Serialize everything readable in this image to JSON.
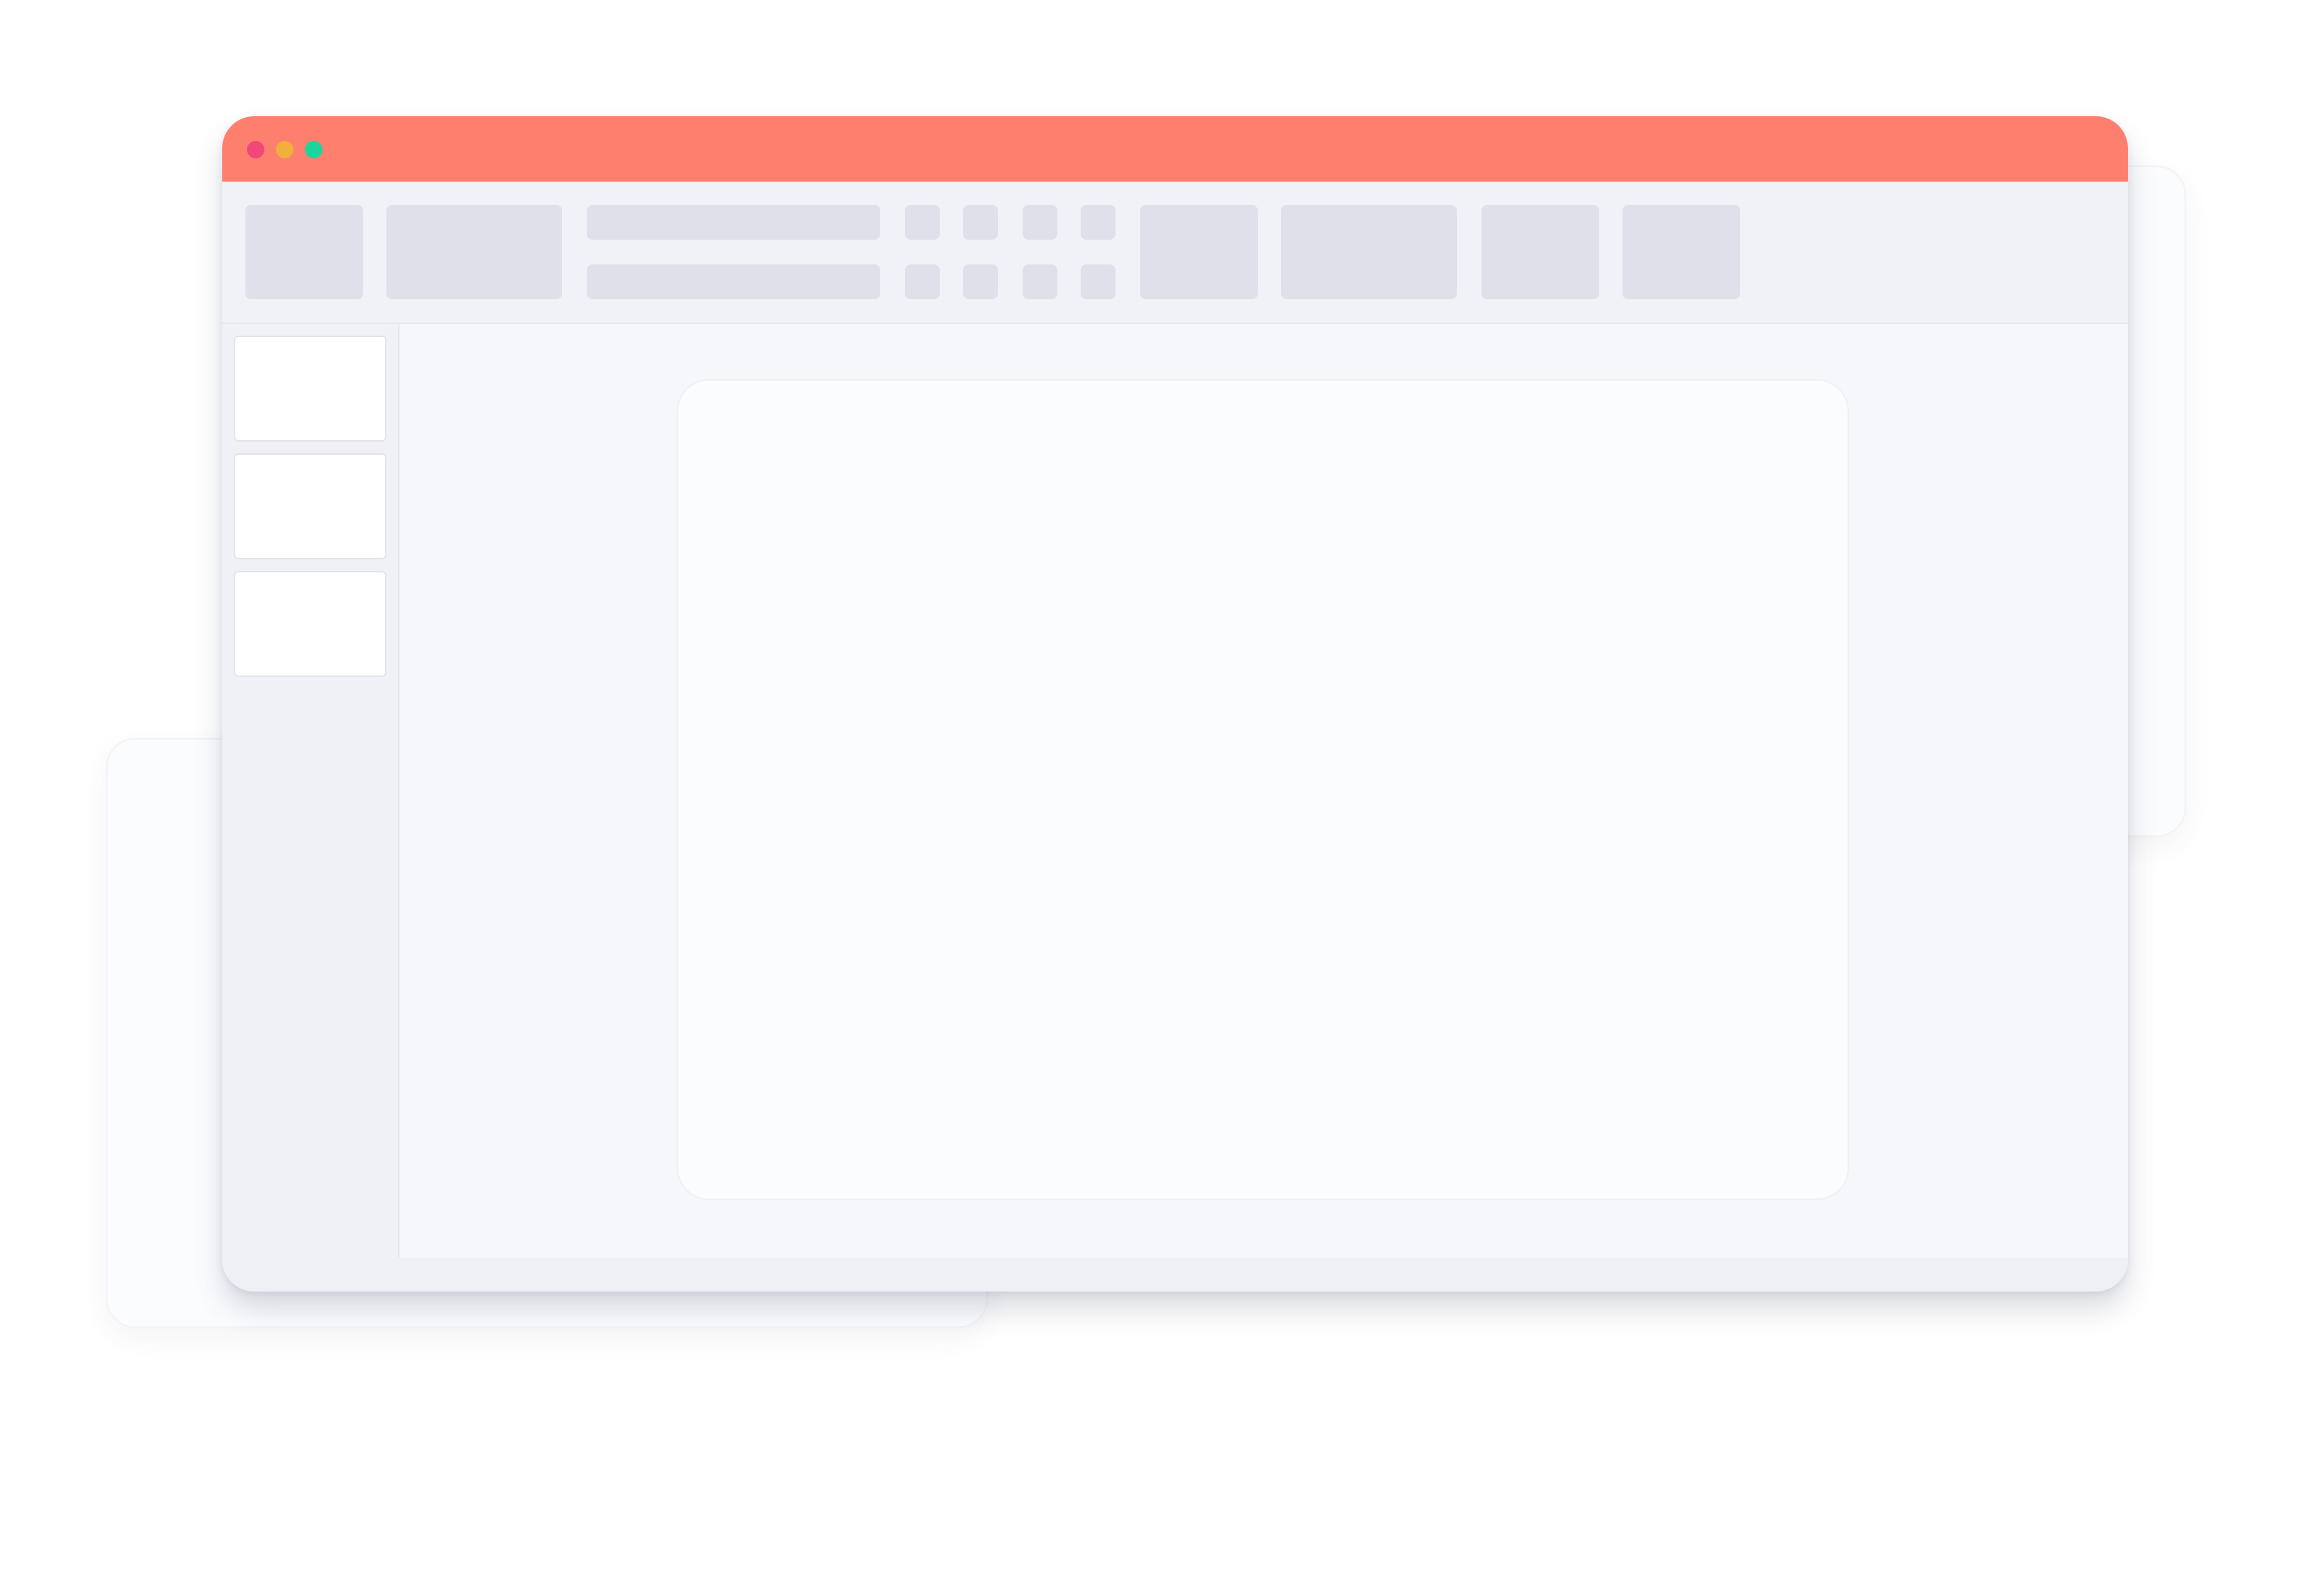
{
  "window": {
    "accent_color": "#ff7f6e",
    "traffic_lights": [
      {
        "name": "close",
        "color": "#f0487a"
      },
      {
        "name": "minimize",
        "color": "#f0b039"
      },
      {
        "name": "maximize",
        "color": "#1ed49c"
      }
    ]
  },
  "toolbar": {
    "placeholder_color": "#dfe0e9"
  },
  "sidebar": {
    "thumbnail_count": 3
  }
}
